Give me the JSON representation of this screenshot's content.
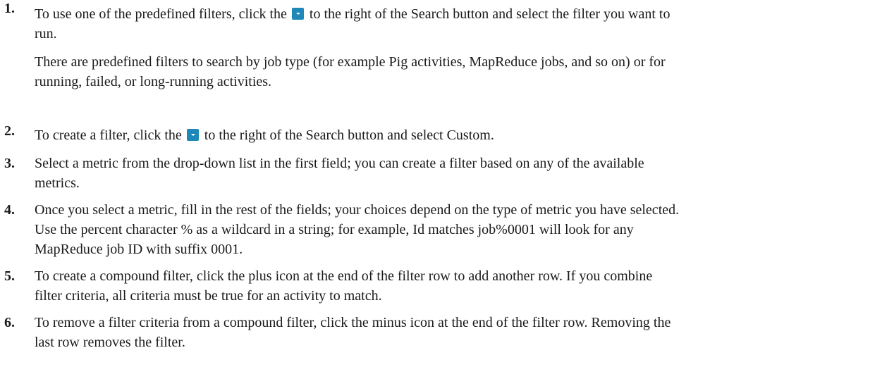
{
  "steps": [
    {
      "number": "1.",
      "line_a_before": "To use one of the predefined filters, click the",
      "line_a_after": "to the right of the Search button and select the filter you want to",
      "line_b": "run.",
      "note_line_a": "There are predefined filters to search by job type (for example Pig activities, MapReduce jobs, and so on) or for",
      "note_line_b": "running, failed, or long-running activities."
    },
    {
      "number": "2.",
      "line_a_before": "To create a filter, click the",
      "line_a_after": "to the right of the Search button and select Custom."
    },
    {
      "number": "3.",
      "line_a": "Select a metric from the drop-down list in the first field; you can create a filter based on any of the available",
      "line_b": "metrics."
    },
    {
      "number": "4.",
      "line_a": "Once you select a metric, fill in the rest of the fields; your choices depend on the type of metric you have selected.",
      "line_b": "Use the percent character % as a wildcard in a string; for example, Id matches job%0001 will look for any",
      "line_c": "MapReduce job ID with suffix 0001."
    },
    {
      "number": "5.",
      "line_a": "To create a compound filter, click the plus icon at the end of the filter row to add another row. If you combine",
      "line_b": "filter criteria, all criteria must be true for an activity to match."
    },
    {
      "number": "6.",
      "line_a": "To remove a filter criteria from a compound filter, click the minus icon at the end of the filter row. Removing the",
      "line_b": "last row removes the filter."
    }
  ],
  "icons": {
    "dropdown_button": "chevron-down-icon",
    "dropdown_color": "#1e88b8"
  }
}
